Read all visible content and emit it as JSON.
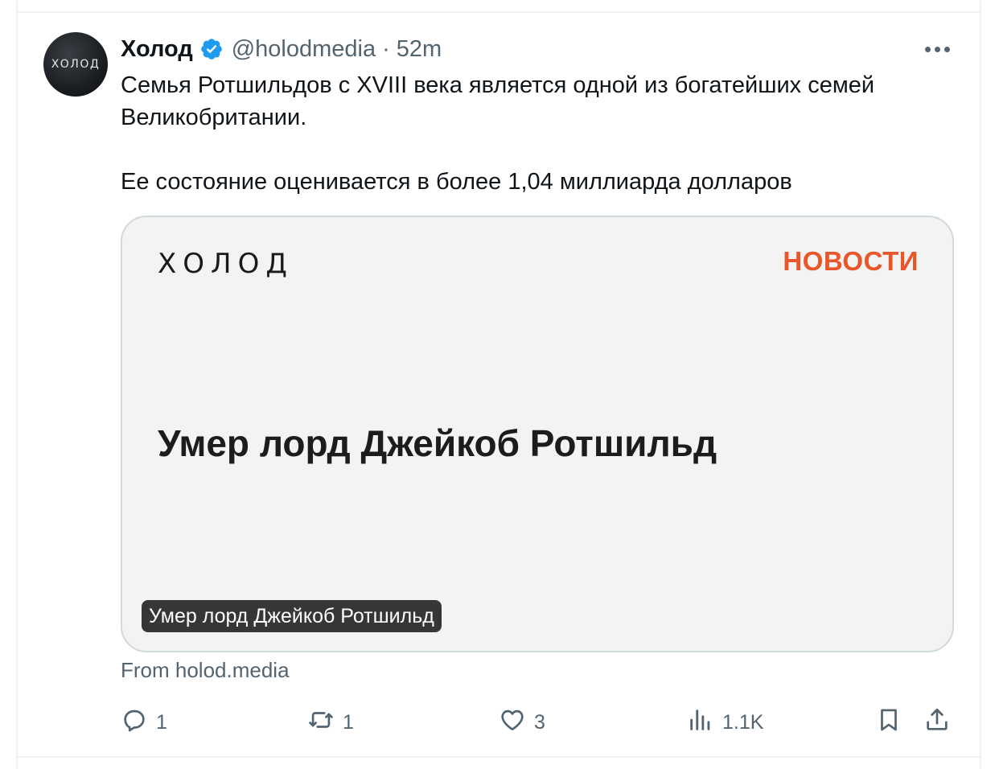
{
  "author": {
    "avatar_text": "ХОЛОД",
    "display_name": "Холод",
    "handle": "@holodmedia",
    "separator": "·",
    "time": "52m",
    "verified_color": "#1d9bf0"
  },
  "tweet": {
    "paragraphs": [
      "Семья Ротшильдов с XVIII века является одной из богатейших семей Великобритании.",
      "Ее состояние оценивается в более 1,04 миллиарда долларов"
    ]
  },
  "card": {
    "brand": "ХОЛОД",
    "category": "НОВОСТИ",
    "headline": "Умер лорд Джейкоб Ротшильд",
    "caption": "Умер лорд Джейкоб Ротшильд",
    "category_color": "#e8562a",
    "source": "From holod.media"
  },
  "actions": {
    "replies": "1",
    "reposts": "1",
    "likes": "3",
    "views": "1.1K"
  },
  "icons": [
    "verified-badge-icon",
    "more-icon",
    "reply-icon",
    "repost-icon",
    "like-icon",
    "views-icon",
    "bookmark-icon",
    "share-icon"
  ]
}
